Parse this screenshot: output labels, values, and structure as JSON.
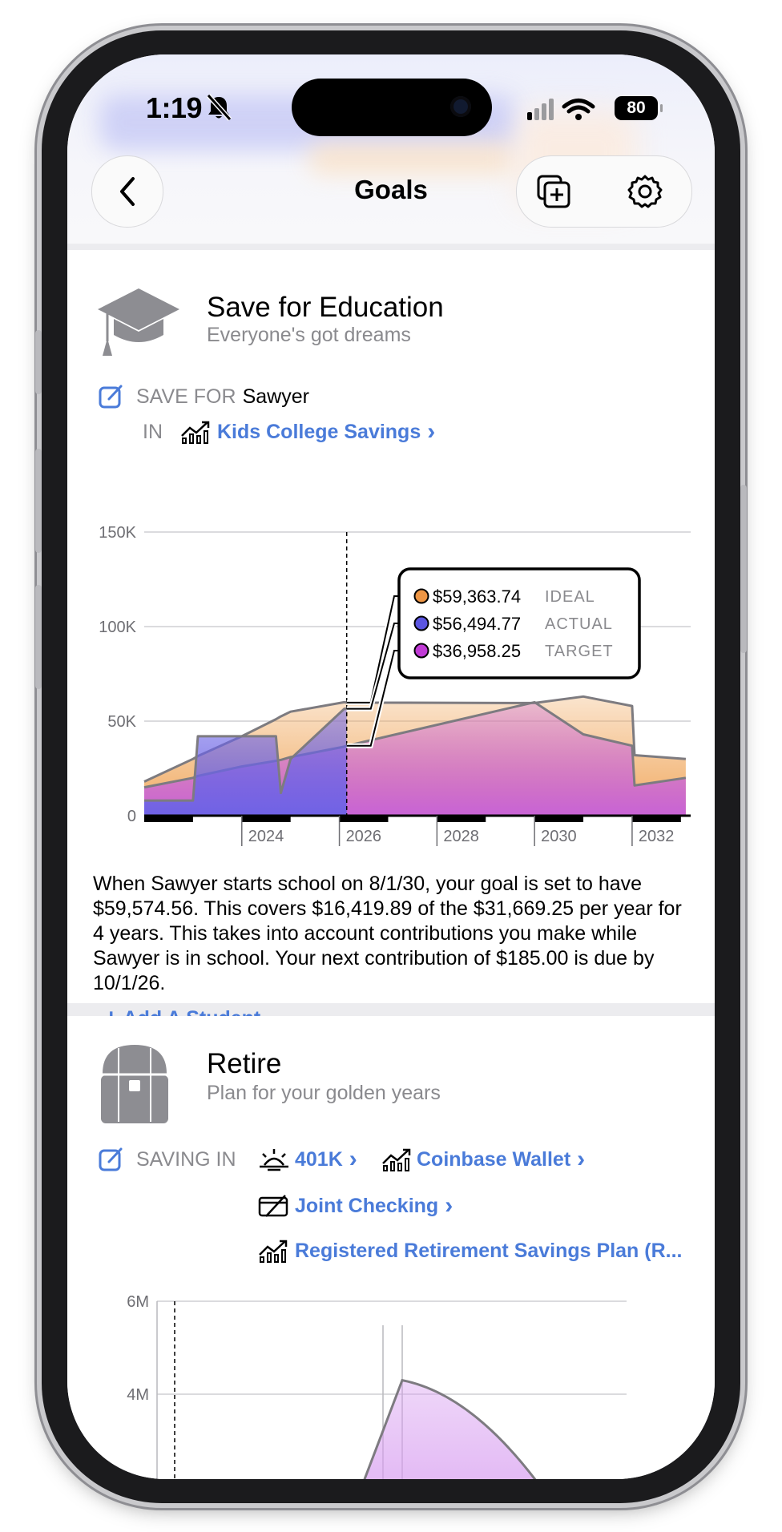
{
  "status_bar": {
    "time": "1:19",
    "battery": "80"
  },
  "nav": {
    "title": "Goals"
  },
  "education": {
    "title": "Save for Education",
    "subtitle": "Everyone's got dreams",
    "save_for_label": "SAVE FOR",
    "student": "Sawyer",
    "in_label": "IN",
    "account": "Kids College Savings",
    "chevron": "›",
    "description": "When Sawyer starts school on 8/1/30, your goal is set to have $59,574.56. This covers $16,419.89 of the $31,669.25 per year for 4 years. This takes into account contributions you make while Sawyer is in school. Your next contribution of $185.00 is due by 10/1/26.",
    "add_student": "Add A Student",
    "add_plus": "+"
  },
  "chart_data": [
    {
      "type": "area",
      "title": "",
      "y_tick_labels": [
        "150K",
        "100K",
        "50K",
        "0"
      ],
      "x_tick_labels": [
        "2024",
        "2026",
        "2028",
        "2030",
        "2032"
      ],
      "ylim": [
        0,
        150000
      ],
      "xlim": [
        2022.0,
        2033.2
      ],
      "grid": true,
      "today_marker_x": 2026.15,
      "x": [
        2022.0,
        2023.0,
        2023.1,
        2024.0,
        2024.7,
        2024.8,
        2025.0,
        2026.1,
        2026.15,
        2030.0,
        2031.0,
        2032.0,
        2032.05,
        2033.1
      ],
      "series": [
        {
          "name": "IDEAL",
          "color": "#f0a65a",
          "values": [
            18000,
            30000,
            31500,
            42000,
            51000,
            52500,
            55000,
            60000,
            59800,
            59574,
            63000,
            58000,
            32000,
            30000
          ]
        },
        {
          "name": "ACTUAL",
          "color": "#6b63e6",
          "values": [
            8000,
            8000,
            42000,
            42000,
            42000,
            12000,
            30000,
            56500,
            56494,
            null,
            null,
            null,
            null,
            null
          ]
        },
        {
          "name": "TARGET",
          "color": "#c65fdc",
          "values": [
            15000,
            20000,
            21000,
            26000,
            29000,
            29500,
            31000,
            36500,
            36958,
            60000,
            43000,
            37000,
            16000,
            20000
          ]
        }
      ],
      "tooltip": [
        {
          "value": "$59,363.74",
          "label": "IDEAL",
          "color": "#ee9645"
        },
        {
          "value": "$56,494.77",
          "label": "ACTUAL",
          "color": "#5b55e0"
        },
        {
          "value": "$36,958.25",
          "label": "TARGET",
          "color": "#c13bd6"
        }
      ]
    },
    {
      "type": "area",
      "title": "",
      "y_tick_labels": [
        "6M",
        "4M"
      ],
      "ylim": [
        0,
        6000000
      ],
      "grid": true,
      "series": [
        {
          "name": "",
          "color": "#d79cf0",
          "values": [
            2400000,
            4300000,
            3000000
          ]
        }
      ]
    }
  ],
  "retire": {
    "title": "Retire",
    "subtitle": "Plan for your golden years",
    "saving_in_label": "SAVING IN",
    "accounts": [
      "401K",
      "Coinbase Wallet",
      "Joint Checking",
      "Registered Retirement Savings Plan (R..."
    ],
    "chevron": "›"
  },
  "icons": [
    "back-chevron-icon",
    "add-copy-icon",
    "gear-icon",
    "graduation-cap-icon",
    "edit-icon",
    "chart-up-icon",
    "treasure-chest-icon",
    "sunrise-icon",
    "card-slash-icon"
  ]
}
